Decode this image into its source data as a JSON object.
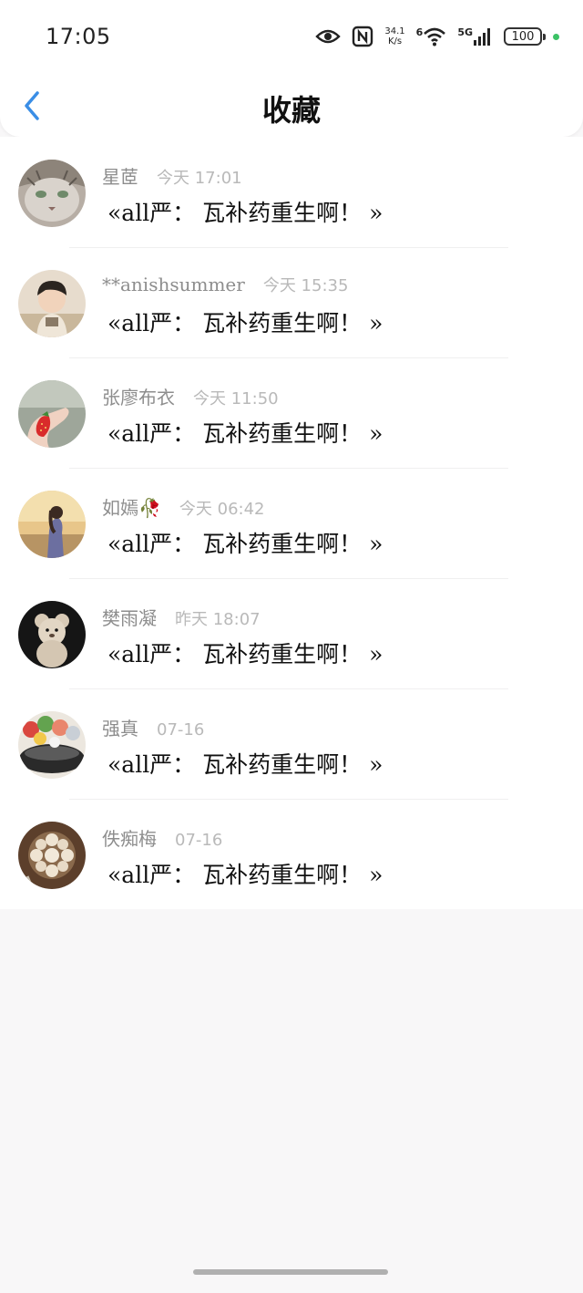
{
  "status_bar": {
    "time": "17:05",
    "net_speed_value": "34.1",
    "net_speed_unit": "K/s",
    "wifi_label": "6",
    "signal_label": "5G",
    "battery": "100",
    "accent_dot_color": "#3cc266"
  },
  "header": {
    "title": "收藏",
    "back_icon": "chevron-left-icon",
    "back_color": "#3a8ee6"
  },
  "favorites": [
    {
      "name": "星茝",
      "time": "今天 17:01",
      "message": "«all严： 瓦补药重生啊！ »"
    },
    {
      "name": "**anishsummer",
      "time": "今天 15:35",
      "message": "«all严： 瓦补药重生啊！ »"
    },
    {
      "name": "张廖布衣",
      "time": "今天 11:50",
      "message": "«all严： 瓦补药重生啊！ »"
    },
    {
      "name": "如嫣🥀",
      "time": "今天 06:42",
      "message": "«all严： 瓦补药重生啊！ »"
    },
    {
      "name": "樊雨凝",
      "time": "昨天 18:07",
      "message": "«all严： 瓦补药重生啊！ »"
    },
    {
      "name": "强真",
      "time": "07-16",
      "message": "«all严： 瓦补药重生啊！ »"
    },
    {
      "name": "佚痴梅",
      "time": "07-16",
      "message": "«all严： 瓦补药重生啊！ »"
    }
  ]
}
